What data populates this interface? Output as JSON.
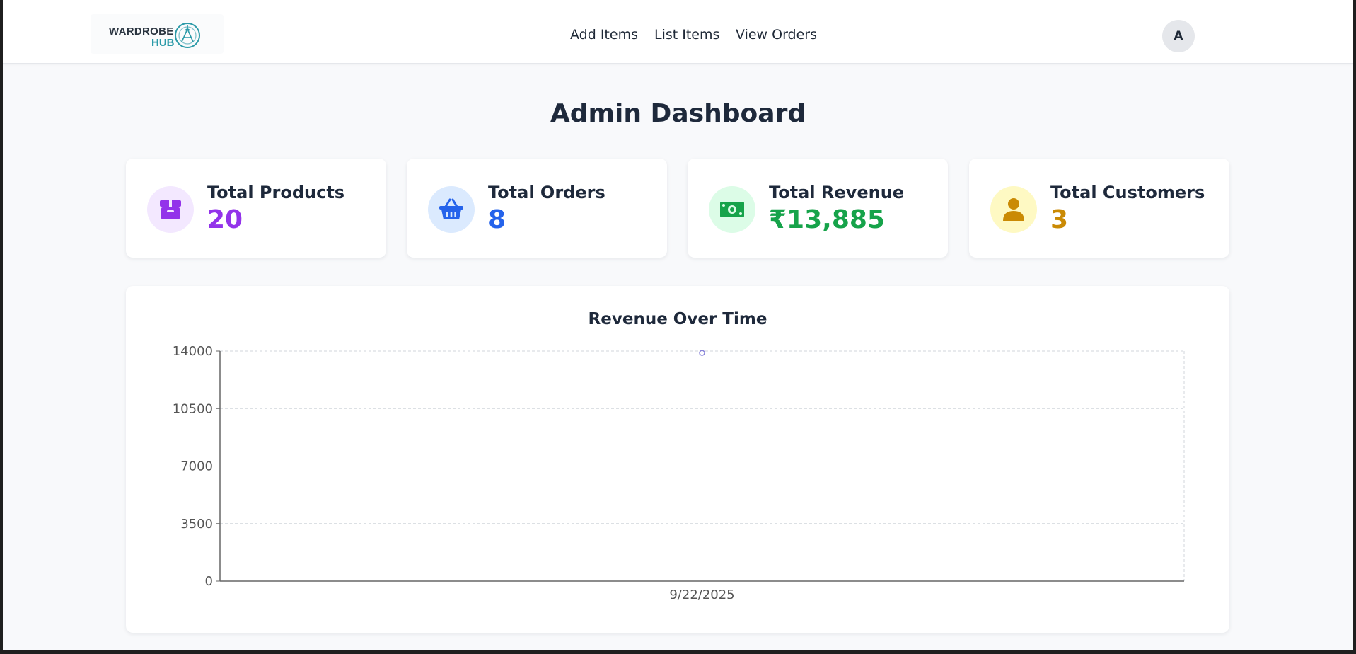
{
  "logo": {
    "line1": "WARDROBE",
    "line2": "HUB",
    "accent": "#2b9aa8"
  },
  "nav": {
    "links": [
      "Add Items",
      "List Items",
      "View Orders"
    ],
    "avatar_initial": "A"
  },
  "page_title": "Admin Dashboard",
  "stats": [
    {
      "label": "Total Products",
      "value": "20",
      "icon": "box-icon",
      "color": "#9333ea",
      "bg": "#f3e8ff"
    },
    {
      "label": "Total Orders",
      "value": "8",
      "icon": "basket-icon",
      "color": "#2563eb",
      "bg": "#dbeafe"
    },
    {
      "label": "Total Revenue",
      "value": "₹13,885",
      "icon": "money-icon",
      "color": "#16a34a",
      "bg": "#dcfce7"
    },
    {
      "label": "Total Customers",
      "value": "3",
      "icon": "user-icon",
      "color": "#ca8a04",
      "bg": "#fef9c3"
    }
  ],
  "chart_data": {
    "type": "line",
    "title": "Revenue Over Time",
    "x": [
      "9/22/2025"
    ],
    "series": [
      {
        "values": [
          13885
        ],
        "color": "#8884d8"
      }
    ],
    "ylim": [
      0,
      14000
    ],
    "yticks": [
      "0",
      "3500",
      "7000",
      "10500",
      "14000"
    ],
    "grid": true
  }
}
